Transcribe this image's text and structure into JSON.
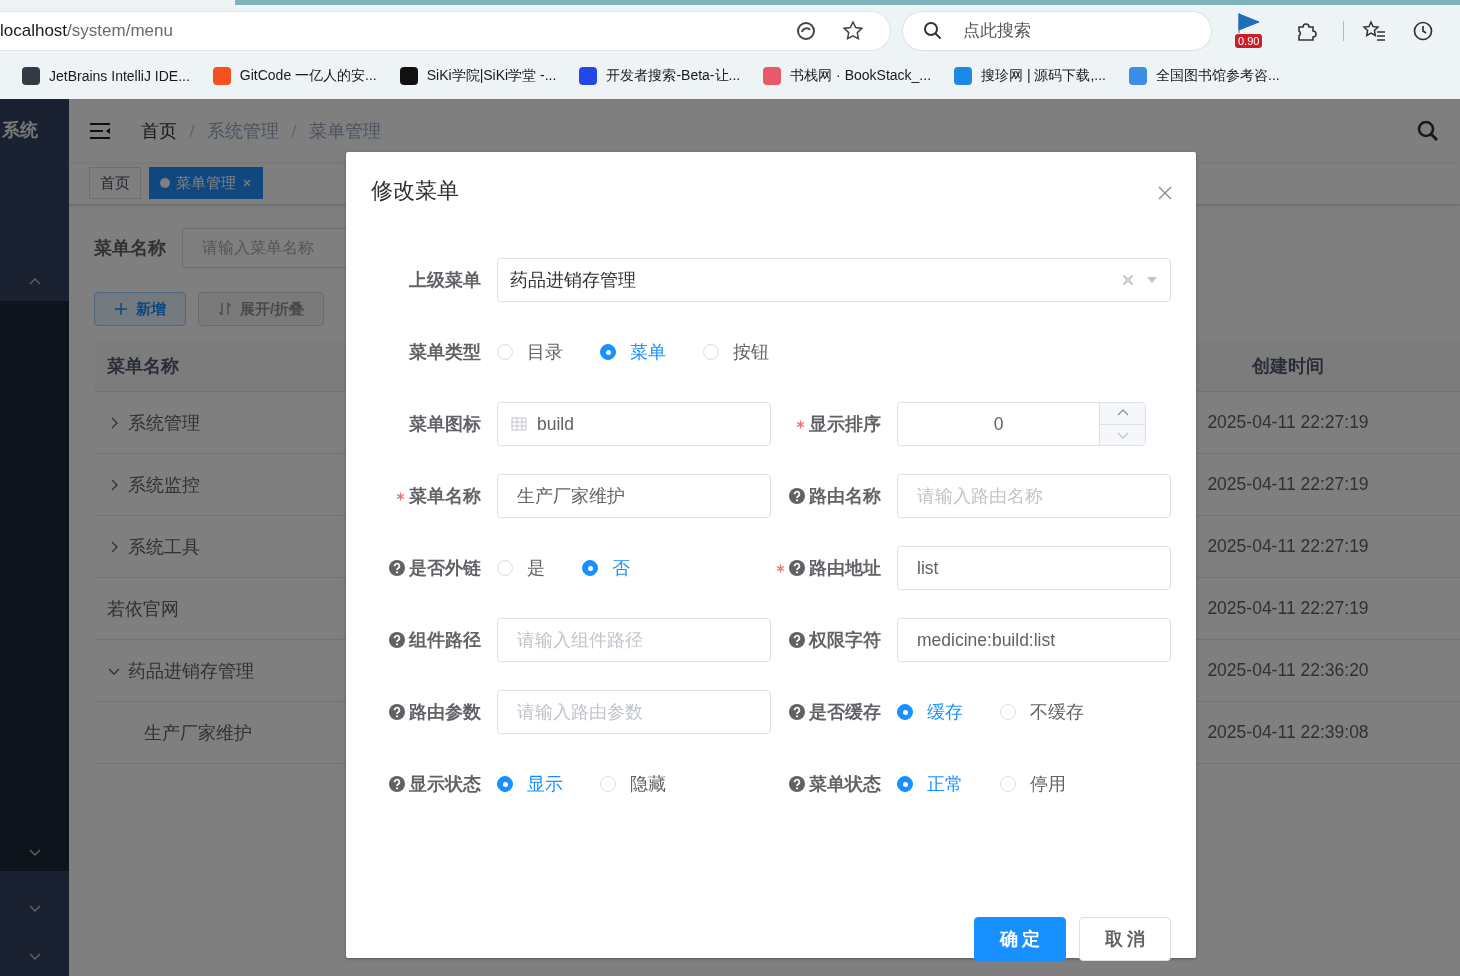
{
  "browser": {
    "url": {
      "host": "localhost",
      "path": "/system/menu"
    },
    "search_placeholder": "点此搜索",
    "badge": "0.90",
    "bookmarks": [
      {
        "label": "JetBrains IntelliJ IDE...",
        "color": "#333a44"
      },
      {
        "label": "GitCode 一亿人的安...",
        "color": "#f4511e"
      },
      {
        "label": "SiKi学院|SiKi学堂 -...",
        "color": "#111111"
      },
      {
        "label": "开发者搜索-Beta-让...",
        "color": "#2448e8"
      },
      {
        "label": "书栈网 · BookStack_...",
        "color": "#e85a6a"
      },
      {
        "label": "搜珍网 | 源码下载,...",
        "color": "#1e88e5"
      },
      {
        "label": "全国图书馆参考咨...",
        "color": "#3a8ee6"
      }
    ]
  },
  "sidebar": {
    "title": "系统",
    "groups": [
      {
        "expanded": true
      },
      {
        "expanded": false
      },
      {
        "expanded": false
      },
      {
        "expanded": false
      }
    ]
  },
  "header": {
    "breadcrumbs": [
      "首页",
      "系统管理",
      "菜单管理"
    ]
  },
  "tags": [
    {
      "label": "首页",
      "selected": false
    },
    {
      "label": "菜单管理",
      "selected": true
    }
  ],
  "search_form": {
    "label": "菜单名称",
    "placeholder": "请输入菜单名称"
  },
  "toolbar": [
    {
      "label": "新增",
      "kind": "add"
    },
    {
      "label": "展开/折叠",
      "kind": "toggle"
    }
  ],
  "table": {
    "columns": [
      "菜单名称",
      "创建时间"
    ],
    "rows": [
      {
        "name": "系统管理",
        "expanded": false,
        "created": "2025-04-11 22:27:19"
      },
      {
        "name": "系统监控",
        "expanded": false,
        "created": "2025-04-11 22:27:19"
      },
      {
        "name": "系统工具",
        "expanded": false,
        "created": "2025-04-11 22:27:19"
      },
      {
        "name": "若依官网",
        "created": "2025-04-11 22:27:19"
      },
      {
        "name": "药品进销存管理",
        "expanded": true,
        "created": "2025-04-11 22:36:20",
        "children": [
          {
            "name": "生产厂家维护",
            "created": "2025-04-11 22:39:08"
          }
        ]
      }
    ]
  },
  "dialog": {
    "title": "修改菜单",
    "rows": [
      [
        {
          "label": "上级菜单",
          "kind": "select",
          "value": "药品进销存管理"
        }
      ],
      [
        {
          "label": "菜单类型",
          "kind": "radio",
          "options": [
            {
              "label": "目录",
              "selected": false
            },
            {
              "label": "菜单",
              "selected": true
            },
            {
              "label": "按钮",
              "selected": false
            }
          ]
        }
      ],
      [
        {
          "label": "菜单图标",
          "kind": "icon-input",
          "value": "build"
        },
        {
          "label": "显示排序",
          "required": true,
          "kind": "number",
          "value": "0"
        }
      ],
      [
        {
          "label": "菜单名称",
          "required": true,
          "kind": "input",
          "value": "生产厂家维护"
        },
        {
          "label": "路由名称",
          "help": true,
          "kind": "input",
          "placeholder": "请输入路由名称"
        }
      ],
      [
        {
          "label": "是否外链",
          "help": true,
          "kind": "radio",
          "options": [
            {
              "label": "是",
              "selected": false
            },
            {
              "label": "否",
              "selected": true
            }
          ]
        },
        {
          "label": "路由地址",
          "required": true,
          "help": true,
          "kind": "input",
          "value": "list"
        }
      ],
      [
        {
          "label": "组件路径",
          "help": true,
          "kind": "input",
          "placeholder": "请输入组件路径"
        },
        {
          "label": "权限字符",
          "help": true,
          "kind": "input",
          "value": "medicine:build:list"
        }
      ],
      [
        {
          "label": "路由参数",
          "help": true,
          "kind": "input",
          "placeholder": "请输入路由参数"
        },
        {
          "label": "是否缓存",
          "help": true,
          "kind": "radio",
          "options": [
            {
              "label": "缓存",
              "selected": true
            },
            {
              "label": "不缓存",
              "selected": false
            }
          ]
        }
      ],
      [
        {
          "label": "显示状态",
          "help": true,
          "kind": "radio",
          "options": [
            {
              "label": "显示",
              "selected": true
            },
            {
              "label": "隐藏",
              "selected": false
            }
          ]
        },
        {
          "label": "菜单状态",
          "help": true,
          "kind": "radio",
          "options": [
            {
              "label": "正常",
              "selected": true
            },
            {
              "label": "停用",
              "selected": false
            }
          ]
        }
      ]
    ],
    "buttons": [
      {
        "label": "确 定",
        "kind": "primary"
      },
      {
        "label": "取 消",
        "kind": "default"
      }
    ]
  }
}
